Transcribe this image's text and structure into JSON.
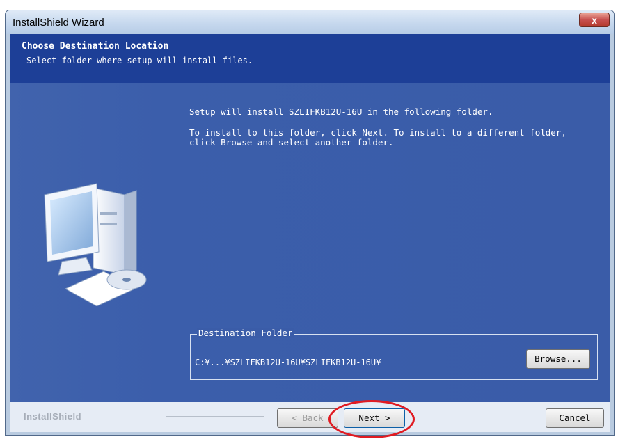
{
  "window": {
    "title": "InstallShield Wizard",
    "close_label": "x"
  },
  "header": {
    "title": "Choose Destination Location",
    "subtitle": "Select folder where setup will install files."
  },
  "body": {
    "line1": "Setup will install SZLIFKB12U-16U in the following folder.",
    "line2": "To install to this folder, click Next. To install to a different folder, click Browse and select another folder."
  },
  "destination": {
    "legend": "Destination Folder",
    "path": "C:¥...¥SZLIFKB12U-16U¥SZLIFKB12U-16U¥",
    "browse_label": "Browse..."
  },
  "footer": {
    "brand": "InstallShield",
    "back_label": "< Back",
    "next_label": "Next >",
    "cancel_label": "Cancel"
  },
  "colors": {
    "header_bg": "#1d3f97",
    "main_bg": "#3a5ca8",
    "highlight": "#e01b22"
  }
}
